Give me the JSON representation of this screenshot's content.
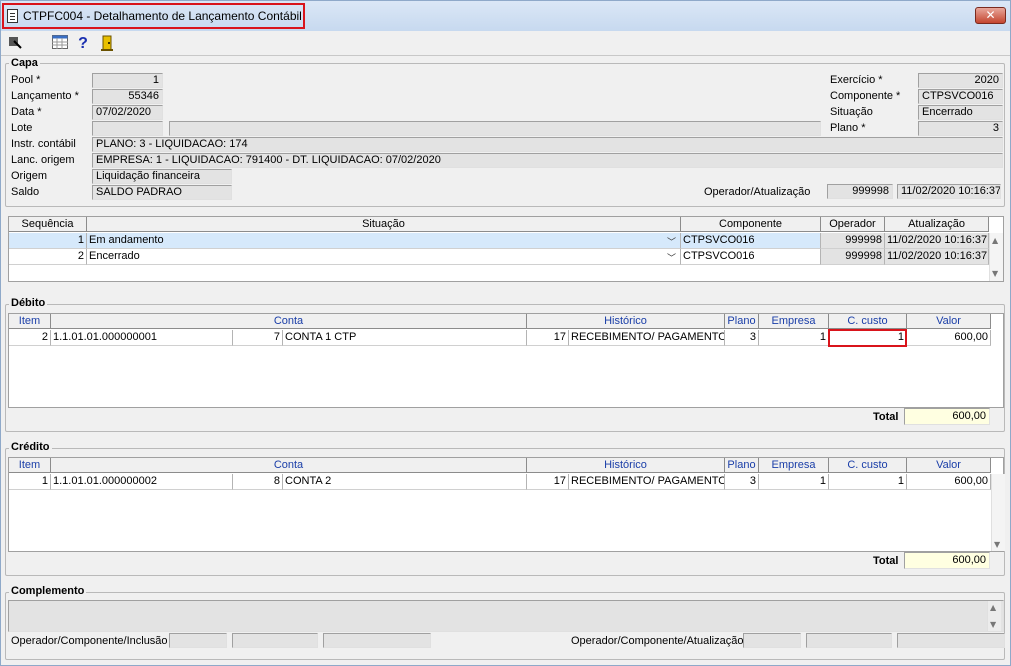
{
  "window": {
    "title": "CTPFC004 - Detalhamento de Lançamento Contábil",
    "close_symbol": "✕"
  },
  "toolbar": {
    "icons": [
      "exit-icon",
      "grid-icon",
      "help-icon",
      "door-icon"
    ],
    "help_symbol": "?"
  },
  "capa": {
    "title": "Capa",
    "labels": {
      "pool": "Pool *",
      "lancamento": "Lançamento *",
      "data": "Data *",
      "lote": "Lote",
      "instr": "Instr. contábil",
      "lanc_origem": "Lanc. origem",
      "origem": "Origem",
      "saldo": "Saldo",
      "exercicio": "Exercício *",
      "componente": "Componente *",
      "situacao": "Situação",
      "plano": "Plano *",
      "operador_atualizacao": "Operador/Atualização"
    },
    "values": {
      "pool": "1",
      "lancamento": "55346",
      "data": "07/02/2020",
      "lote": "",
      "lote_desc": "",
      "instr": "PLANO: 3 - LIQUIDACAO: 174",
      "lanc_origem": "EMPRESA: 1 - LIQUIDACAO: 791400 - DT. LIQUIDACAO: 07/02/2020",
      "origem": "Liquidação financeira",
      "saldo": "SALDO PADRAO",
      "exercicio": "2020",
      "componente": "CTPSVCO016",
      "situacao": "Encerrado",
      "plano": "3",
      "operador": "999998",
      "atualizacao": "11/02/2020 10:16:37"
    }
  },
  "situacao_grid": {
    "headers": [
      "Sequência",
      "Situação",
      "Componente",
      "Operador",
      "Atualização"
    ],
    "rows": [
      {
        "seq": "1",
        "situacao": "Em andamento",
        "componente": "CTPSVCO016",
        "operador": "999998",
        "atualizacao": "11/02/2020 10:16:37"
      },
      {
        "seq": "2",
        "situacao": "Encerrado",
        "componente": "CTPSVCO016",
        "operador": "999998",
        "atualizacao": "11/02/2020 10:16:37"
      }
    ],
    "dropdown_symbol": "﹀"
  },
  "debito": {
    "title": "Débito",
    "headers": [
      "Item",
      "Conta",
      "Histórico",
      "Plano",
      "Empresa",
      "C. custo",
      "Valor"
    ],
    "rows": [
      {
        "item": "2",
        "conta_code": "1.1.01.01.000000001",
        "conta_num": "7",
        "conta_nome": "CONTA 1 CTP",
        "hist_num": "17",
        "hist_nome": "RECEBIMENTO/ PAGAMENTO",
        "plano": "3",
        "empresa": "1",
        "ccusto": "1",
        "valor": "600,00"
      }
    ],
    "total_label": "Total",
    "total": "600,00"
  },
  "credito": {
    "title": "Crédito",
    "headers": [
      "Item",
      "Conta",
      "Histórico",
      "Plano",
      "Empresa",
      "C. custo",
      "Valor"
    ],
    "rows": [
      {
        "item": "1",
        "conta_code": "1.1.01.01.000000002",
        "conta_num": "8",
        "conta_nome": "CONTA 2",
        "hist_num": "17",
        "hist_nome": "RECEBIMENTO/ PAGAMENTO",
        "plano": "3",
        "empresa": "1",
        "ccusto": "1",
        "valor": "600,00"
      }
    ],
    "total_label": "Total",
    "total": "600,00"
  },
  "complemento": {
    "title": "Complemento",
    "text": "",
    "op_inclusao_label": "Operador/Componente/Inclusão",
    "op_atualizacao_label": "Operador/Componente/Atualização",
    "op_inclusao": [
      "",
      "",
      ""
    ],
    "op_atualizacao": [
      "",
      "",
      ""
    ]
  },
  "scroll": {
    "up": "▲",
    "down": "▼"
  },
  "colors": {
    "selected_row": "#d6e9fb",
    "highlight": "#d9141b",
    "total_bg": "#ffffe1",
    "header_blue": "#1a3ea8"
  }
}
